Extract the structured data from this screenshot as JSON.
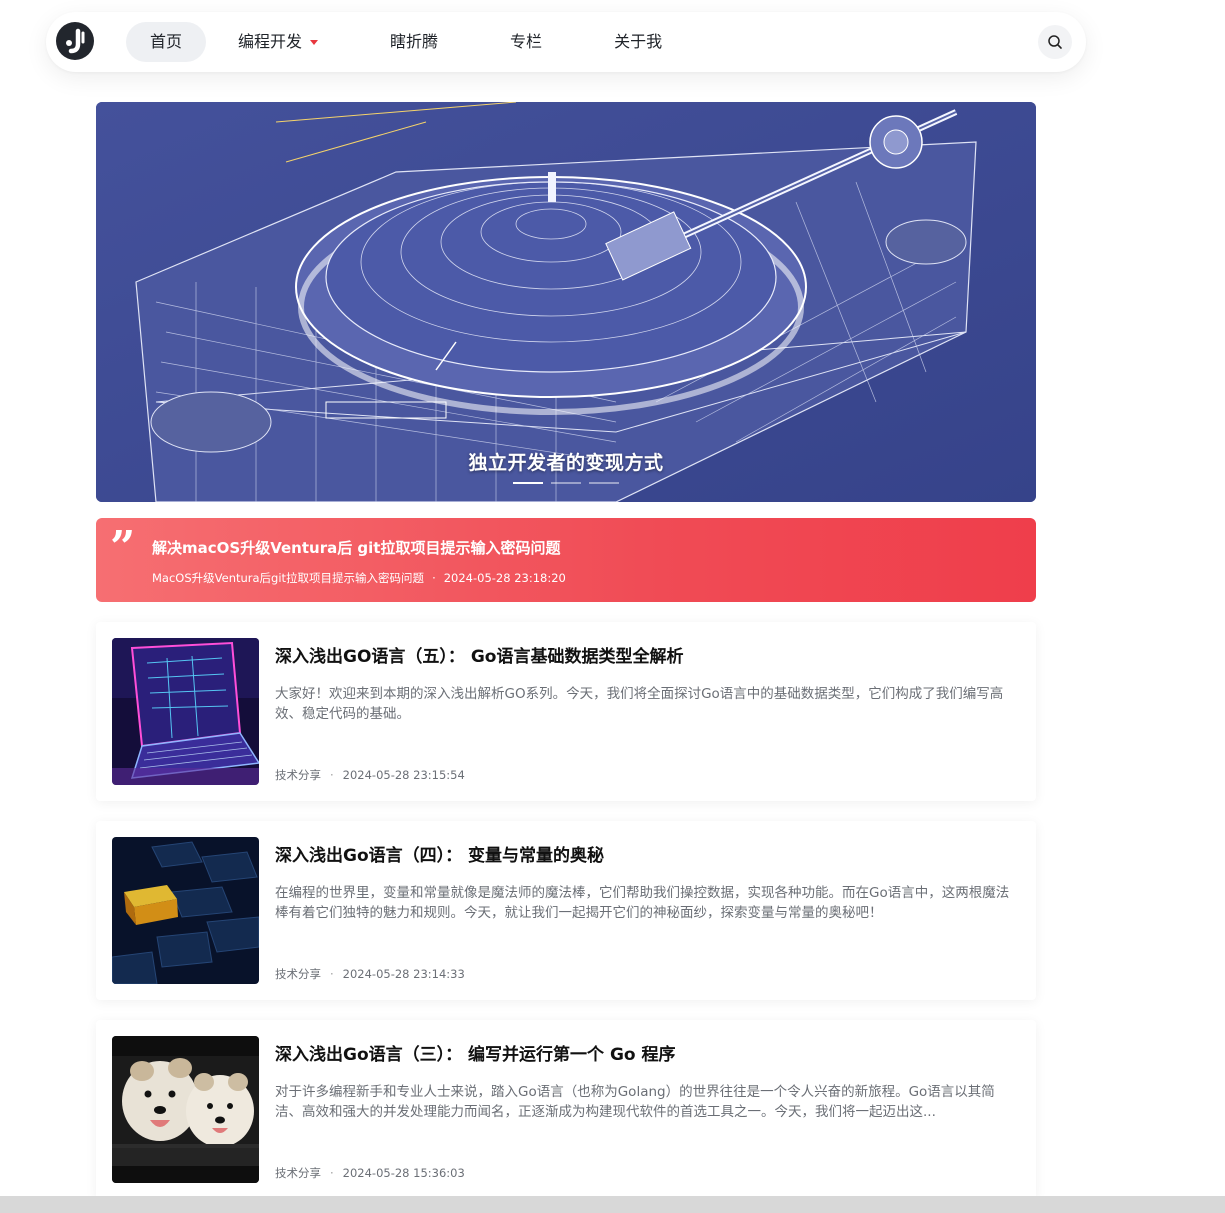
{
  "header": {
    "nav": [
      {
        "label": "首页",
        "active": true
      },
      {
        "label": "编程开发",
        "has_dropdown": true
      },
      {
        "label": "瞎折腾"
      },
      {
        "label": "专栏"
      },
      {
        "label": "关于我"
      }
    ],
    "icons": {
      "logo": "brand-logo",
      "search": "search-icon"
    }
  },
  "banner": {
    "title": "独立开发者的变现方式",
    "slides": 3,
    "active_slide": 1
  },
  "featured": {
    "title": "解决macOS升级Ventura后 git拉取项目提示输入密码问题",
    "subtitle": "MacOS升级Ventura后git拉取项目提示输入密码问题",
    "date": "2024-05-28 23:18:20",
    "separator": "·"
  },
  "articles": [
    {
      "title": "深入浅出GO语言（五）： Go语言基础数据类型全解析",
      "desc": "大家好！欢迎来到本期的深入浅出解析GO系列。今天，我们将全面探讨Go语言中的基础数据类型，它们构成了我们编写高效、稳定代码的基础。",
      "category": "技术分享",
      "date": "2024-05-28 23:15:54"
    },
    {
      "title": "深入浅出Go语言（四）： 变量与常量的奥秘",
      "desc": "在编程的世界里，变量和常量就像是魔法师的魔法棒，它们帮助我们操控数据，实现各种功能。而在Go语言中，这两根魔法棒有着它们独特的魅力和规则。今天，就让我们一起揭开它们的神秘面纱，探索变量与常量的奥秘吧！",
      "category": "技术分享",
      "date": "2024-05-28 23:14:33"
    },
    {
      "title": "深入浅出Go语言（三）： 编写并运行第一个 Go 程序",
      "desc": "对于许多编程新手和专业人士来说，踏入Go语言（也称为Golang）的世界往往是一个令人兴奋的新旅程。Go语言以其简洁、高效和强大的并发处理能力而闻名，正逐渐成为构建现代软件的首选工具之一。今天，我们将一起迈出这...",
      "category": "技术分享",
      "date": "2024-05-28 15:36:03"
    }
  ],
  "meta_separator": "·",
  "colors": {
    "accent_red": "#f04b55",
    "banner_blue": "#3d4b94",
    "active_nav_bg": "#eef0f3",
    "caret": "#e8373f"
  }
}
